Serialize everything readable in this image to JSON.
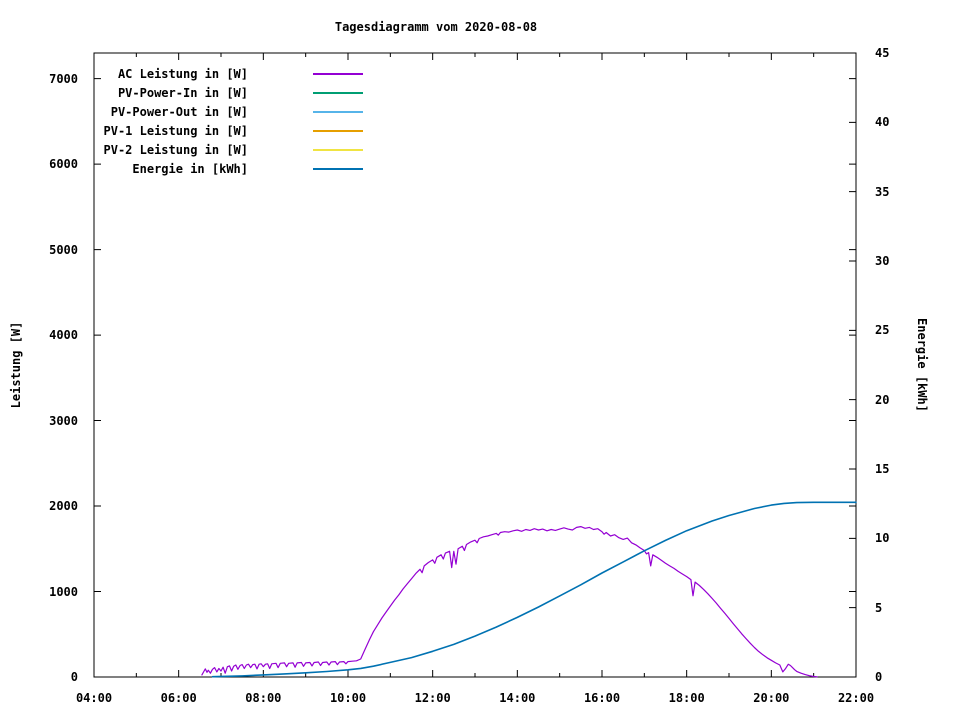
{
  "title": "Tagesdiagramm vom 2020-08-08",
  "axes": {
    "y1": {
      "label": "Leistung [W]"
    },
    "y2": {
      "label": "Energie [kWh]"
    }
  },
  "legend": {
    "items": [
      {
        "label": "AC Leistung in [W]",
        "color": "#9400d3"
      },
      {
        "label": "PV-Power-In in [W]",
        "color": "#009e73"
      },
      {
        "label": "PV-Power-Out in [W]",
        "color": "#56b4e9"
      },
      {
        "label": "PV-1 Leistung in [W]",
        "color": "#e69f00"
      },
      {
        "label": "PV-2 Leistung in [W]",
        "color": "#f0e442"
      },
      {
        "label": "Energie in [kWh]",
        "color": "#0072b2"
      }
    ]
  },
  "chart_data": {
    "type": "line",
    "title": "Tagesdiagramm vom 2020-08-08",
    "grid": false,
    "legend_position": "top-left-inside",
    "x": {
      "unit": "time-of-day-hours",
      "range": [
        4,
        22
      ],
      "major_ticks": [
        {
          "v": 4,
          "label": "04:00"
        },
        {
          "v": 6,
          "label": "06:00"
        },
        {
          "v": 8,
          "label": "08:00"
        },
        {
          "v": 10,
          "label": "10:00"
        },
        {
          "v": 12,
          "label": "12:00"
        },
        {
          "v": 14,
          "label": "14:00"
        },
        {
          "v": 16,
          "label": "16:00"
        },
        {
          "v": 18,
          "label": "18:00"
        },
        {
          "v": 20,
          "label": "20:00"
        },
        {
          "v": 22,
          "label": "22:00"
        }
      ],
      "minor_ticks": [
        5,
        7,
        9,
        11,
        13,
        15,
        17,
        19,
        21
      ]
    },
    "y1": {
      "label": "Leistung [W]",
      "range": [
        0,
        7300
      ],
      "major_ticks": [
        {
          "v": 0,
          "label": "0"
        },
        {
          "v": 1000,
          "label": "1000"
        },
        {
          "v": 2000,
          "label": "2000"
        },
        {
          "v": 3000,
          "label": "3000"
        },
        {
          "v": 4000,
          "label": "4000"
        },
        {
          "v": 5000,
          "label": "5000"
        },
        {
          "v": 6000,
          "label": "6000"
        },
        {
          "v": 7000,
          "label": "7000"
        }
      ]
    },
    "y2": {
      "label": "Energie [kWh]",
      "range": [
        0,
        45
      ],
      "major_ticks": [
        {
          "v": 0,
          "label": "0"
        },
        {
          "v": 5,
          "label": "5"
        },
        {
          "v": 10,
          "label": "10"
        },
        {
          "v": 15,
          "label": "15"
        },
        {
          "v": 20,
          "label": "20"
        },
        {
          "v": 25,
          "label": "25"
        },
        {
          "v": 30,
          "label": "30"
        },
        {
          "v": 35,
          "label": "35"
        },
        {
          "v": 40,
          "label": "40"
        },
        {
          "v": 45,
          "label": "45"
        }
      ]
    },
    "series": [
      {
        "name": "AC Leistung in [W]",
        "color": "#9400d3",
        "axis": "y1",
        "width": 1.2,
        "points": [
          [
            6.55,
            25
          ],
          [
            6.6,
            70
          ],
          [
            6.63,
            95
          ],
          [
            6.67,
            55
          ],
          [
            6.7,
            80
          ],
          [
            6.75,
            45
          ],
          [
            6.8,
            90
          ],
          [
            6.85,
            110
          ],
          [
            6.9,
            60
          ],
          [
            6.95,
            100
          ],
          [
            7.0,
            70
          ],
          [
            7.05,
            115
          ],
          [
            7.1,
            45
          ],
          [
            7.15,
            120
          ],
          [
            7.2,
            130
          ],
          [
            7.25,
            70
          ],
          [
            7.3,
            125
          ],
          [
            7.35,
            140
          ],
          [
            7.4,
            90
          ],
          [
            7.45,
            135
          ],
          [
            7.5,
            145
          ],
          [
            7.55,
            100
          ],
          [
            7.6,
            140
          ],
          [
            7.65,
            150
          ],
          [
            7.7,
            110
          ],
          [
            7.75,
            145
          ],
          [
            7.8,
            150
          ],
          [
            7.85,
            95
          ],
          [
            7.9,
            150
          ],
          [
            7.95,
            155
          ],
          [
            8.0,
            120
          ],
          [
            8.05,
            150
          ],
          [
            8.1,
            155
          ],
          [
            8.15,
            100
          ],
          [
            8.2,
            155
          ],
          [
            8.3,
            160
          ],
          [
            8.35,
            110
          ],
          [
            8.4,
            160
          ],
          [
            8.5,
            165
          ],
          [
            8.55,
            120
          ],
          [
            8.6,
            160
          ],
          [
            8.7,
            165
          ],
          [
            8.75,
            115
          ],
          [
            8.8,
            165
          ],
          [
            8.9,
            170
          ],
          [
            8.95,
            125
          ],
          [
            9.0,
            165
          ],
          [
            9.1,
            170
          ],
          [
            9.15,
            130
          ],
          [
            9.2,
            170
          ],
          [
            9.3,
            175
          ],
          [
            9.35,
            135
          ],
          [
            9.4,
            170
          ],
          [
            9.5,
            175
          ],
          [
            9.55,
            140
          ],
          [
            9.6,
            175
          ],
          [
            9.7,
            180
          ],
          [
            9.75,
            145
          ],
          [
            9.8,
            175
          ],
          [
            9.9,
            180
          ],
          [
            9.95,
            155
          ],
          [
            10.0,
            180
          ],
          [
            10.1,
            185
          ],
          [
            10.2,
            190
          ],
          [
            10.3,
            210
          ],
          [
            10.4,
            320
          ],
          [
            10.5,
            430
          ],
          [
            10.6,
            530
          ],
          [
            10.7,
            610
          ],
          [
            10.8,
            690
          ],
          [
            10.9,
            760
          ],
          [
            11.0,
            830
          ],
          [
            11.1,
            900
          ],
          [
            11.2,
            960
          ],
          [
            11.3,
            1030
          ],
          [
            11.4,
            1090
          ],
          [
            11.5,
            1150
          ],
          [
            11.6,
            1210
          ],
          [
            11.7,
            1260
          ],
          [
            11.75,
            1220
          ],
          [
            11.8,
            1300
          ],
          [
            11.9,
            1340
          ],
          [
            12.0,
            1370
          ],
          [
            12.05,
            1330
          ],
          [
            12.1,
            1400
          ],
          [
            12.2,
            1430
          ],
          [
            12.25,
            1380
          ],
          [
            12.3,
            1450
          ],
          [
            12.4,
            1470
          ],
          [
            12.45,
            1280
          ],
          [
            12.5,
            1470
          ],
          [
            12.55,
            1320
          ],
          [
            12.6,
            1500
          ],
          [
            12.7,
            1530
          ],
          [
            12.75,
            1480
          ],
          [
            12.8,
            1550
          ],
          [
            12.9,
            1580
          ],
          [
            13.0,
            1600
          ],
          [
            13.05,
            1570
          ],
          [
            13.1,
            1620
          ],
          [
            13.2,
            1640
          ],
          [
            13.3,
            1650
          ],
          [
            13.4,
            1665
          ],
          [
            13.5,
            1680
          ],
          [
            13.55,
            1660
          ],
          [
            13.6,
            1690
          ],
          [
            13.7,
            1700
          ],
          [
            13.8,
            1695
          ],
          [
            13.9,
            1710
          ],
          [
            14.0,
            1720
          ],
          [
            14.1,
            1705
          ],
          [
            14.2,
            1725
          ],
          [
            14.3,
            1715
          ],
          [
            14.4,
            1735
          ],
          [
            14.5,
            1720
          ],
          [
            14.6,
            1730
          ],
          [
            14.7,
            1710
          ],
          [
            14.8,
            1725
          ],
          [
            14.9,
            1715
          ],
          [
            15.0,
            1730
          ],
          [
            15.1,
            1745
          ],
          [
            15.2,
            1730
          ],
          [
            15.3,
            1720
          ],
          [
            15.4,
            1750
          ],
          [
            15.5,
            1760
          ],
          [
            15.6,
            1740
          ],
          [
            15.7,
            1750
          ],
          [
            15.8,
            1725
          ],
          [
            15.9,
            1735
          ],
          [
            16.0,
            1700
          ],
          [
            16.05,
            1670
          ],
          [
            16.1,
            1690
          ],
          [
            16.2,
            1650
          ],
          [
            16.3,
            1665
          ],
          [
            16.4,
            1630
          ],
          [
            16.5,
            1610
          ],
          [
            16.6,
            1625
          ],
          [
            16.7,
            1570
          ],
          [
            16.8,
            1545
          ],
          [
            16.9,
            1510
          ],
          [
            17.0,
            1480
          ],
          [
            17.05,
            1440
          ],
          [
            17.1,
            1455
          ],
          [
            17.15,
            1300
          ],
          [
            17.2,
            1430
          ],
          [
            17.3,
            1400
          ],
          [
            17.4,
            1365
          ],
          [
            17.5,
            1330
          ],
          [
            17.6,
            1300
          ],
          [
            17.7,
            1270
          ],
          [
            17.8,
            1235
          ],
          [
            17.9,
            1205
          ],
          [
            18.0,
            1175
          ],
          [
            18.1,
            1140
          ],
          [
            18.15,
            950
          ],
          [
            18.2,
            1110
          ],
          [
            18.3,
            1070
          ],
          [
            18.4,
            1025
          ],
          [
            18.5,
            975
          ],
          [
            18.6,
            920
          ],
          [
            18.7,
            865
          ],
          [
            18.8,
            805
          ],
          [
            18.9,
            745
          ],
          [
            19.0,
            685
          ],
          [
            19.1,
            625
          ],
          [
            19.2,
            565
          ],
          [
            19.3,
            505
          ],
          [
            19.4,
            450
          ],
          [
            19.5,
            395
          ],
          [
            19.6,
            345
          ],
          [
            19.7,
            300
          ],
          [
            19.8,
            260
          ],
          [
            19.9,
            225
          ],
          [
            20.0,
            195
          ],
          [
            20.1,
            165
          ],
          [
            20.2,
            140
          ],
          [
            20.27,
            60
          ],
          [
            20.33,
            95
          ],
          [
            20.4,
            150
          ],
          [
            20.45,
            135
          ],
          [
            20.5,
            110
          ],
          [
            20.55,
            85
          ],
          [
            20.6,
            65
          ],
          [
            20.7,
            45
          ],
          [
            20.8,
            28
          ],
          [
            20.9,
            15
          ],
          [
            21.0,
            6
          ],
          [
            21.08,
            2
          ]
        ]
      },
      {
        "name": "PV-Power-In in [W]",
        "color": "#009e73",
        "axis": "y1",
        "width": 1.2,
        "points": []
      },
      {
        "name": "PV-Power-Out in [W]",
        "color": "#56b4e9",
        "axis": "y1",
        "width": 1.2,
        "points": []
      },
      {
        "name": "PV-1 Leistung in [W]",
        "color": "#e69f00",
        "axis": "y1",
        "width": 1.2,
        "points": []
      },
      {
        "name": "PV-2 Leistung in [W]",
        "color": "#f0e442",
        "axis": "y1",
        "width": 1.2,
        "points": []
      },
      {
        "name": "Energie in [kWh]",
        "color": "#0072b2",
        "axis": "y2",
        "width": 1.6,
        "points": [
          [
            6.8,
            0.02
          ],
          [
            7.5,
            0.08
          ],
          [
            8.0,
            0.15
          ],
          [
            8.5,
            0.22
          ],
          [
            9.0,
            0.3
          ],
          [
            9.5,
            0.4
          ],
          [
            10.0,
            0.52
          ],
          [
            10.3,
            0.62
          ],
          [
            10.6,
            0.78
          ],
          [
            11.0,
            1.05
          ],
          [
            11.5,
            1.4
          ],
          [
            12.0,
            1.85
          ],
          [
            12.5,
            2.35
          ],
          [
            13.0,
            2.95
          ],
          [
            13.5,
            3.6
          ],
          [
            14.0,
            4.3
          ],
          [
            14.5,
            5.05
          ],
          [
            15.0,
            5.85
          ],
          [
            15.5,
            6.65
          ],
          [
            16.0,
            7.5
          ],
          [
            16.5,
            8.3
          ],
          [
            17.0,
            9.1
          ],
          [
            17.5,
            9.85
          ],
          [
            18.0,
            10.55
          ],
          [
            18.3,
            10.9
          ],
          [
            18.6,
            11.25
          ],
          [
            19.0,
            11.65
          ],
          [
            19.3,
            11.9
          ],
          [
            19.6,
            12.15
          ],
          [
            20.0,
            12.4
          ],
          [
            20.3,
            12.52
          ],
          [
            20.6,
            12.58
          ],
          [
            21.0,
            12.6
          ],
          [
            21.5,
            12.6
          ],
          [
            22.0,
            12.6
          ]
        ]
      }
    ]
  }
}
